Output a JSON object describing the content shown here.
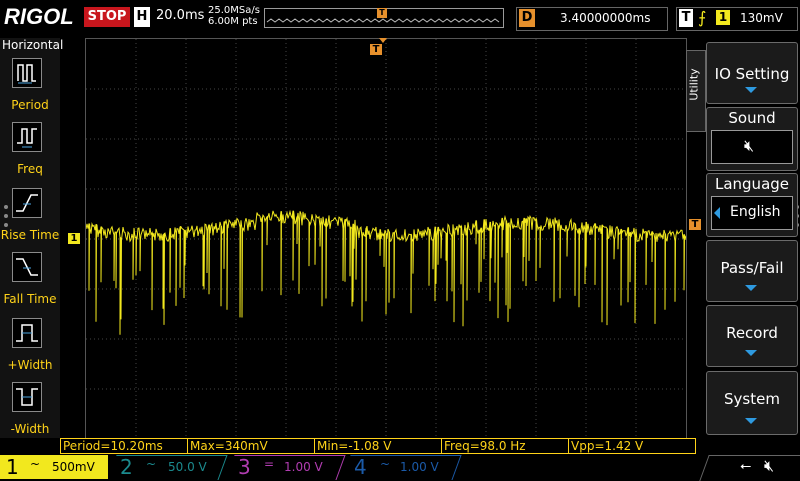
{
  "header": {
    "brand": "RIGOL",
    "run_state": "STOP",
    "h_label": "H",
    "timebase": "20.0ms",
    "sample_rate": "25.0MSa/s",
    "memory_depth": "6.00M pts",
    "memory_trigger_marker": "T",
    "delay_label": "D",
    "delay_value": "3.40000000ms",
    "trigger_label": "T",
    "trigger_edge_icon": "rising-edge-icon",
    "trigger_source": "1",
    "trigger_level": "130mV"
  },
  "horizontal_menu": {
    "title": "Horizontal",
    "items": [
      {
        "label": "Period",
        "icon": "period-icon"
      },
      {
        "label": "Freq",
        "icon": "frequency-icon"
      },
      {
        "label": "Rise Time",
        "icon": "rise-time-icon"
      },
      {
        "label": "Fall Time",
        "icon": "fall-time-icon"
      },
      {
        "label": "+Width",
        "icon": "positive-width-icon"
      },
      {
        "label": "-Width",
        "icon": "negative-width-icon"
      }
    ]
  },
  "screen": {
    "trigger_marker": "T",
    "ch1_marker": "1",
    "trigger_level_marker": "T",
    "colors": {
      "ch1": "#f2e81e",
      "accent": "#e6902c",
      "grid": "#444444"
    }
  },
  "utility_menu": {
    "tab_label": "Utility",
    "buttons": [
      {
        "label": "IO Setting"
      },
      {
        "label": "Sound",
        "sub_icon": "speaker-muted-icon"
      },
      {
        "label": "Language",
        "sub_value": "English"
      },
      {
        "label": "Pass/Fail"
      },
      {
        "label": "Record"
      },
      {
        "label": "System"
      }
    ]
  },
  "measurements": [
    {
      "label": "Period=10.20ms"
    },
    {
      "label": "Max=340mV"
    },
    {
      "label": "Min=-1.08 V"
    },
    {
      "label": "Freq=98.0 Hz"
    },
    {
      "label": "Vpp=1.42 V"
    }
  ],
  "channels": [
    {
      "num": "1",
      "coupling": "~",
      "scale": "500mV",
      "active": true,
      "color": "#f2e81e"
    },
    {
      "num": "2",
      "coupling": "~",
      "scale": "50.0 V",
      "active": false,
      "color": "#1b8a8e"
    },
    {
      "num": "3",
      "coupling": "=",
      "scale": "1.00 V",
      "active": false,
      "color": "#b13db1"
    },
    {
      "num": "4",
      "coupling": "~",
      "scale": "1.00 V",
      "active": false,
      "color": "#1b5aa8"
    }
  ],
  "status_icons": {
    "usb": "usb-icon",
    "sound": "speaker-muted-icon"
  }
}
